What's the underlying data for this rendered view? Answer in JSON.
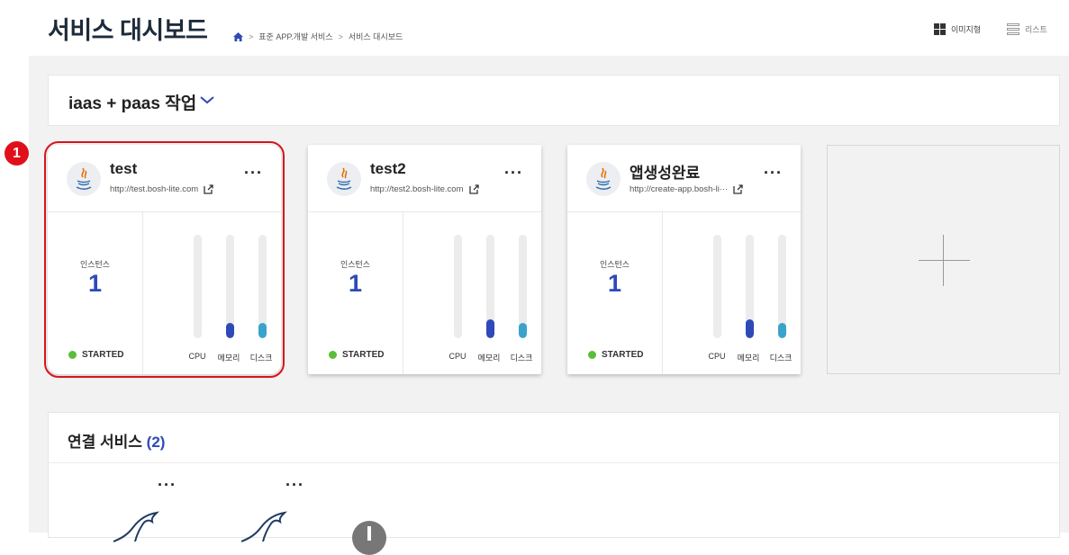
{
  "header": {
    "title": "서비스 대시보드",
    "breadcrumb": [
      "표준 APP.개발 서비스",
      "서비스 대시보드"
    ],
    "view_image_label": "이미지형",
    "view_list_label": "리스트"
  },
  "group": {
    "title": "iaas + paas 작업"
  },
  "annotation_badge": "1",
  "apps": [
    {
      "name": "test",
      "url": "http://test.bosh-lite.com",
      "instance_label": "인스턴스",
      "instances": "1",
      "status": "STARTED",
      "status_color": "#5cbd3a",
      "usage": {
        "cpu": 0.0,
        "memory": 0.15,
        "disk": 0.15
      },
      "metric_labels": [
        "CPU",
        "메모리",
        "디스크"
      ]
    },
    {
      "name": "test2",
      "url": "http://test2.bosh-lite.com",
      "instance_label": "인스턴스",
      "instances": "1",
      "status": "STARTED",
      "status_color": "#5cbd3a",
      "usage": {
        "cpu": 0.0,
        "memory": 0.18,
        "disk": 0.15
      },
      "metric_labels": [
        "CPU",
        "메모리",
        "디스크"
      ]
    },
    {
      "name": "앱생성완료",
      "url": "http://create-app.bosh-li···",
      "instance_label": "인스턴스",
      "instances": "1",
      "status": "STARTED",
      "status_color": "#5cbd3a",
      "usage": {
        "cpu": 0.0,
        "memory": 0.18,
        "disk": 0.15
      },
      "metric_labels": [
        "CPU",
        "메모리",
        "디스크"
      ]
    }
  ],
  "services": {
    "title": "연결 서비스",
    "count": "(2)"
  },
  "colors": {
    "accent_blue": "#2e4ab8",
    "disk_teal": "#3aa3cc",
    "highlight_red": "#d8141c"
  },
  "icons": [
    "home-icon",
    "grid-view-icon",
    "list-view-icon",
    "chevron-down-icon",
    "java-icon",
    "external-link-icon",
    "more-icon",
    "plus-icon",
    "mysql-dolphin-icon"
  ]
}
